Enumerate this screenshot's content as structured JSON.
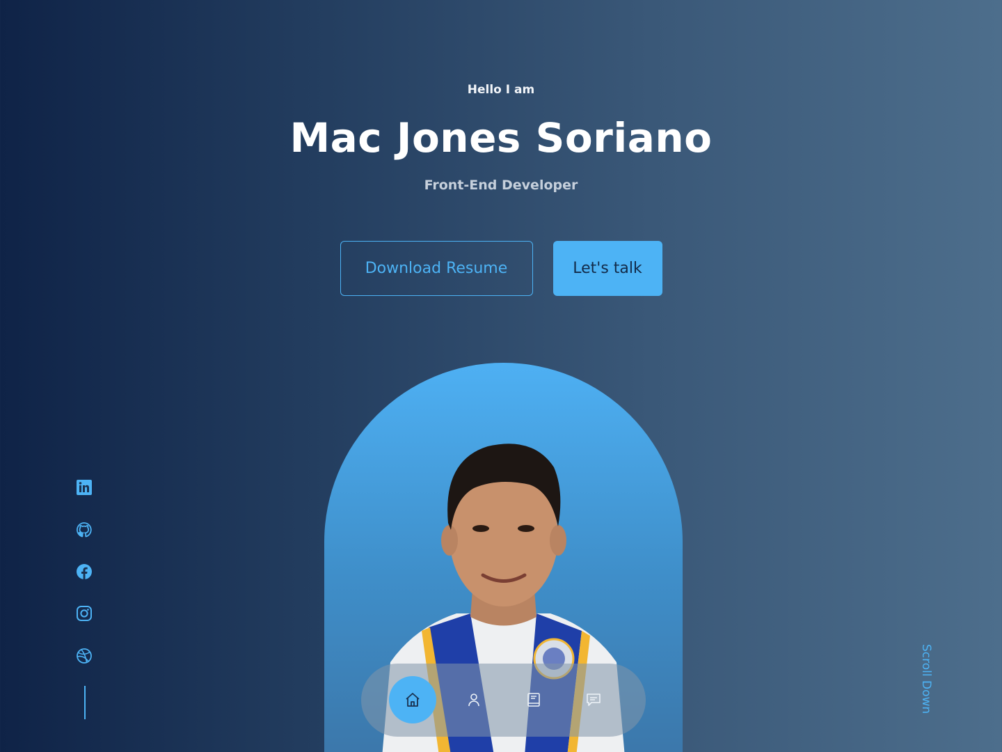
{
  "hero": {
    "greeting": "Hello I am",
    "name": "Mac Jones Soriano",
    "role": "Front-End Developer"
  },
  "cta": {
    "download_label": "Download Resume",
    "talk_label": "Let's talk"
  },
  "socials": [
    {
      "icon": "linkedin-icon"
    },
    {
      "icon": "github-icon"
    },
    {
      "icon": "facebook-icon"
    },
    {
      "icon": "instagram-icon"
    },
    {
      "icon": "dribbble-icon"
    }
  ],
  "scroll": {
    "label": "Scroll Down"
  },
  "nav": {
    "items": [
      {
        "icon": "home-icon",
        "active": true
      },
      {
        "icon": "user-icon",
        "active": false
      },
      {
        "icon": "book-icon",
        "active": false
      },
      {
        "icon": "message-icon",
        "active": false
      }
    ]
  },
  "colors": {
    "accent": "#4db3f5",
    "bg_left": "#0f2347",
    "bg_right": "#4d6e8c"
  }
}
